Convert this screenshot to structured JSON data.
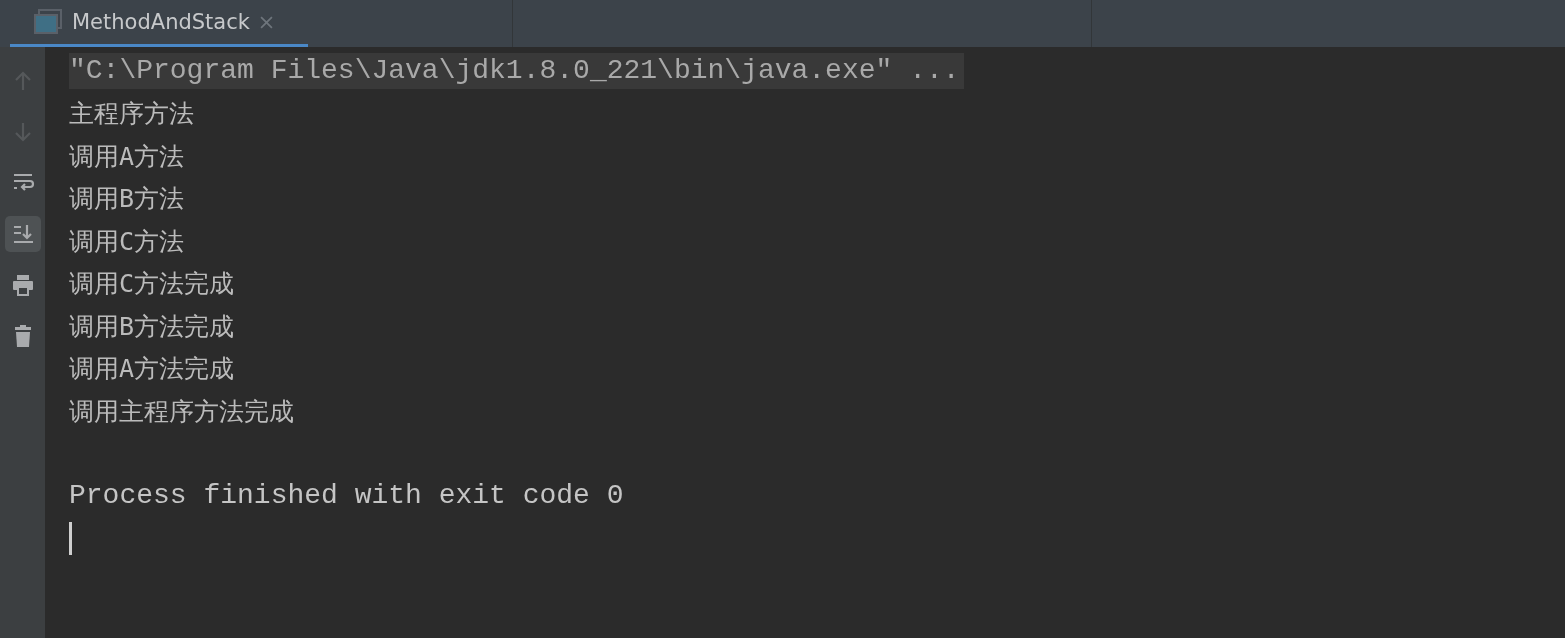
{
  "tabs": [
    {
      "label": "MethodAndStack",
      "selected": true,
      "closable": true
    }
  ],
  "toolbar": [
    {
      "kind": "up",
      "disabled": true,
      "selected": false
    },
    {
      "kind": "down",
      "disabled": true,
      "selected": false
    },
    {
      "kind": "wrap",
      "disabled": false,
      "selected": false
    },
    {
      "kind": "scroll-end",
      "disabled": false,
      "selected": true
    },
    {
      "kind": "print",
      "disabled": false,
      "selected": false
    },
    {
      "kind": "trash",
      "disabled": false,
      "selected": false
    }
  ],
  "console": {
    "lines": [
      {
        "kind": "command",
        "text": "\"C:\\Program Files\\Java\\jdk1.8.0_221\\bin\\java.exe\" ..."
      },
      {
        "kind": "output",
        "text": "主程序方法"
      },
      {
        "kind": "output",
        "text": "调用A方法"
      },
      {
        "kind": "output",
        "text": "调用B方法"
      },
      {
        "kind": "output",
        "text": "调用C方法"
      },
      {
        "kind": "output",
        "text": "调用C方法完成"
      },
      {
        "kind": "output",
        "text": "调用B方法完成"
      },
      {
        "kind": "output",
        "text": "调用A方法完成"
      },
      {
        "kind": "output",
        "text": "调用主程序方法完成"
      },
      {
        "kind": "exit",
        "text": "Process finished with exit code 0"
      }
    ]
  }
}
